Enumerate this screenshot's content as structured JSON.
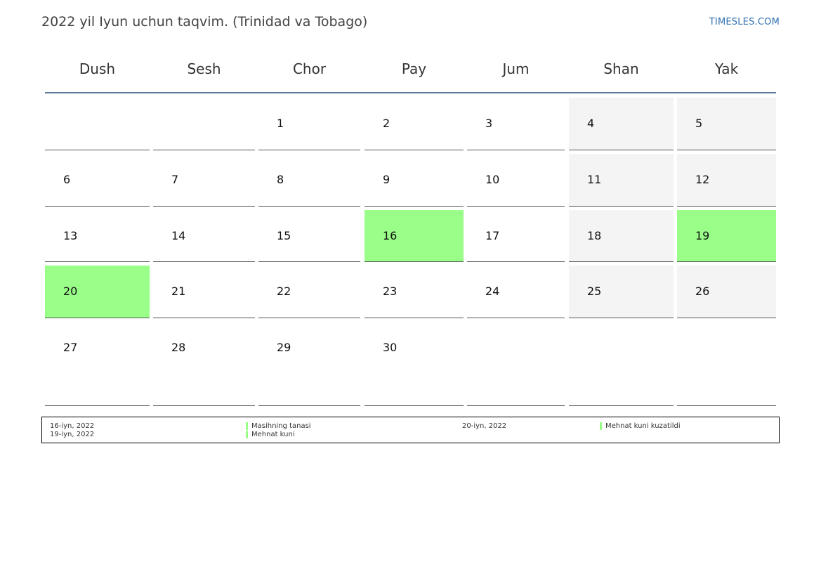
{
  "header": {
    "title": "2022 yil Iyun uchun taqvim. (Trinidad va Tobago)",
    "brand": "TIMESLES.COM"
  },
  "weekdays": [
    "Dush",
    "Sesh",
    "Chor",
    "Pay",
    "Jum",
    "Shan",
    "Yak"
  ],
  "colors": {
    "holiday": "#99ff88",
    "weekend": "#f4f4f4",
    "header_rule": "#5b7a9a",
    "brand": "#2f6fb0"
  },
  "weeks": [
    [
      null,
      null,
      "1",
      "2",
      "3",
      "4",
      "5"
    ],
    [
      "6",
      "7",
      "8",
      "9",
      "10",
      "11",
      "12"
    ],
    [
      "13",
      "14",
      "15",
      "16",
      "17",
      "18",
      "19"
    ],
    [
      "20",
      "21",
      "22",
      "23",
      "24",
      "25",
      "26"
    ],
    [
      "27",
      "28",
      "29",
      "30",
      null,
      null,
      null
    ]
  ],
  "holiday_days": [
    "16",
    "19",
    "20"
  ],
  "legend": [
    {
      "date": "16-iyn, 2022",
      "name": "Masihning tanasi"
    },
    {
      "date": "19-iyn, 2022",
      "name": "Mehnat kuni"
    },
    {
      "date": "20-iyn, 2022",
      "name": "Mehnat kuni kuzatildi"
    }
  ]
}
